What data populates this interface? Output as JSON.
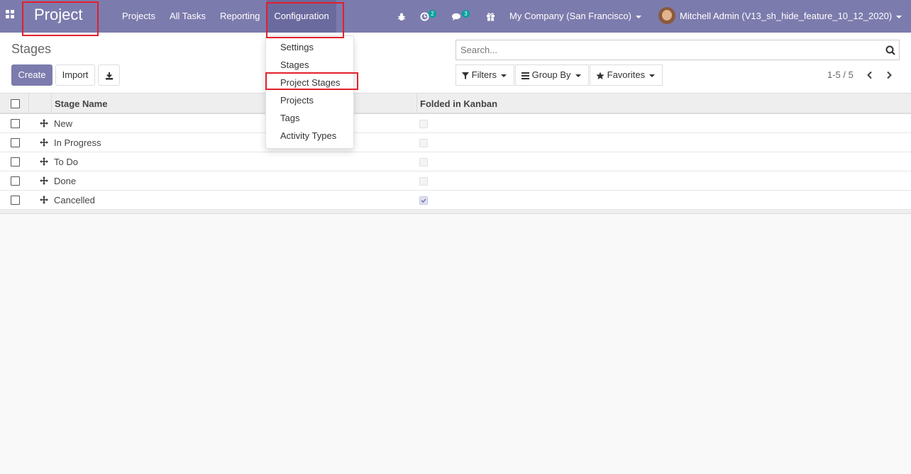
{
  "navbar": {
    "brand": "Project",
    "menu": [
      {
        "label": "Projects"
      },
      {
        "label": "All Tasks"
      },
      {
        "label": "Reporting"
      },
      {
        "label": "Configuration"
      }
    ],
    "activity_count": "2",
    "messages_count": "3",
    "company": "My Company (San Francisco)",
    "user": "Mitchell Admin (V13_sh_hide_feature_10_12_2020)",
    "colors": {
      "bar": "#7c7bad",
      "badge": "#00a09d",
      "highlight": "#e3202a"
    }
  },
  "control_panel": {
    "title": "Stages",
    "create_label": "Create",
    "import_label": "Import",
    "search_placeholder": "Search...",
    "filters_label": "Filters",
    "groupby_label": "Group By",
    "favorites_label": "Favorites",
    "pager": "1-5 / 5"
  },
  "dropdown": {
    "items": [
      {
        "label": "Settings"
      },
      {
        "label": "Stages"
      },
      {
        "label": "Project Stages"
      },
      {
        "label": "Projects"
      },
      {
        "label": "Tags"
      },
      {
        "label": "Activity Types"
      }
    ]
  },
  "table": {
    "headers": {
      "name": "Stage Name",
      "folded": "Folded in Kanban"
    },
    "rows": [
      {
        "name": "New",
        "folded": false
      },
      {
        "name": "In Progress",
        "folded": false
      },
      {
        "name": "To Do",
        "folded": false
      },
      {
        "name": "Done",
        "folded": false
      },
      {
        "name": "Cancelled",
        "folded": true
      }
    ]
  }
}
